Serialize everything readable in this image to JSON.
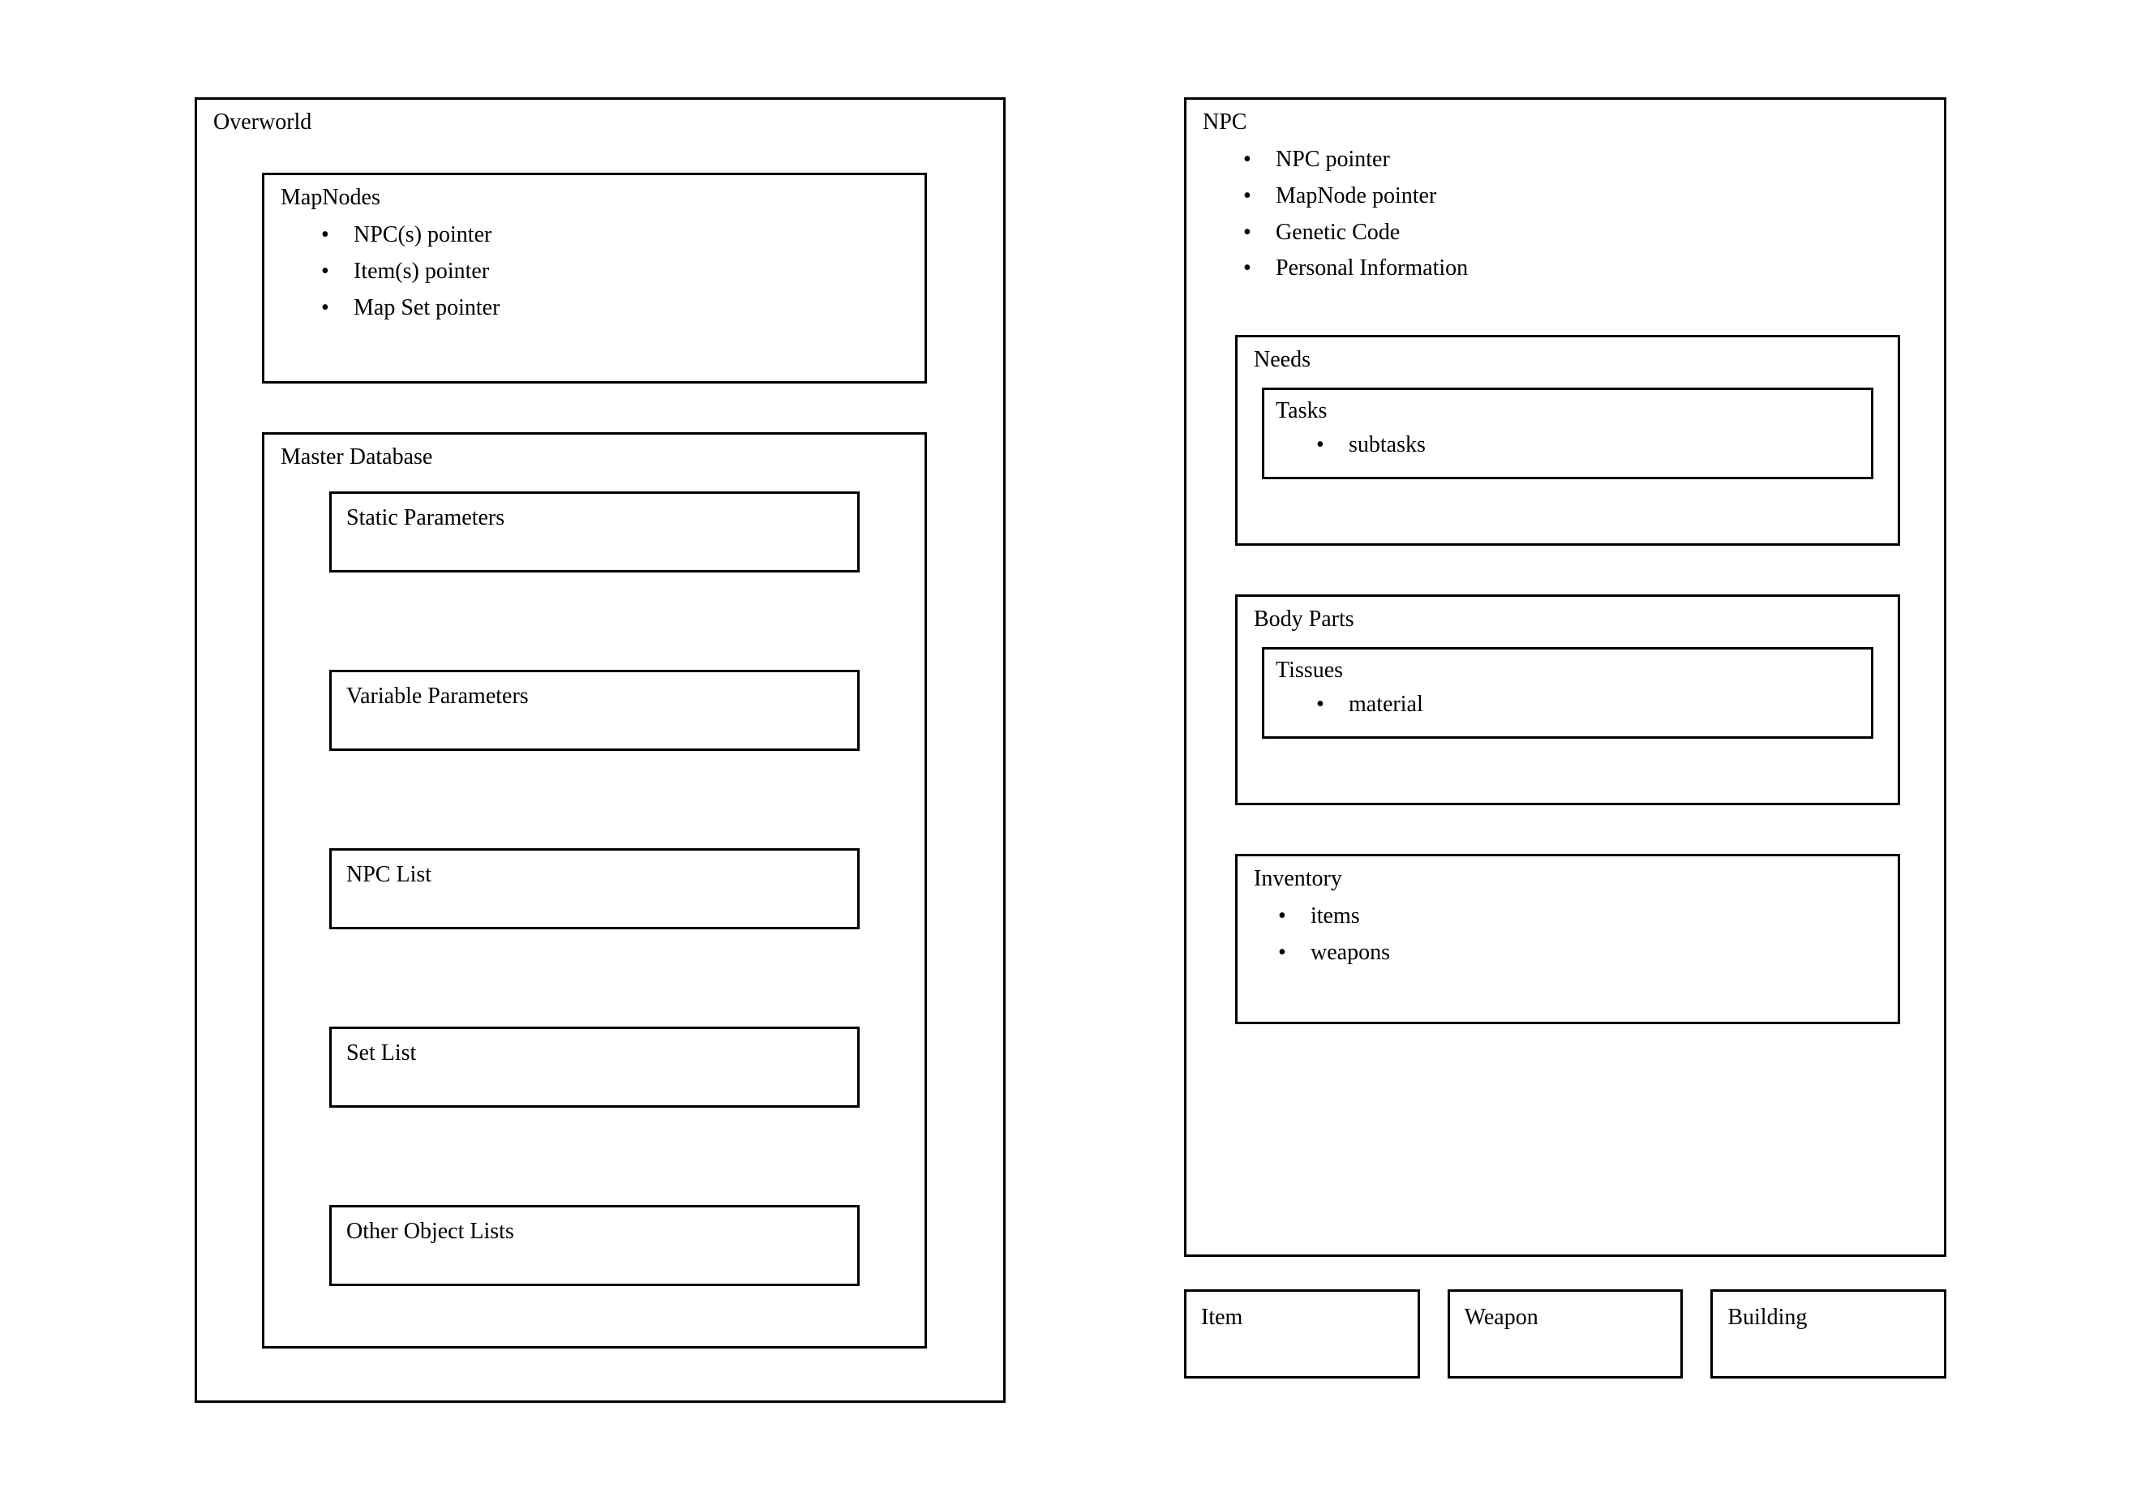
{
  "left": {
    "overworld": {
      "title": "Overworld",
      "mapnodes": {
        "title": "MapNodes",
        "items": [
          "NPC(s) pointer",
          "Item(s) pointer",
          "Map Set pointer"
        ]
      },
      "masterdb": {
        "title": "Master Database",
        "items": [
          "Static Parameters",
          "Variable Parameters",
          "NPC List",
          "Set List",
          "Other Object Lists"
        ]
      }
    }
  },
  "right": {
    "npc": {
      "title": "NPC",
      "items": [
        "NPC pointer",
        "MapNode pointer",
        "Genetic Code",
        "Personal Information"
      ],
      "needs": {
        "title": "Needs",
        "tasks": {
          "title": "Tasks",
          "items": [
            "subtasks"
          ]
        }
      },
      "bodyparts": {
        "title": "Body Parts",
        "tissues": {
          "title": "Tissues",
          "items": [
            "material"
          ]
        }
      },
      "inventory": {
        "title": "Inventory",
        "items": [
          "items",
          "weapons"
        ]
      }
    },
    "bottom": [
      "Item",
      "Weapon",
      "Building"
    ]
  }
}
